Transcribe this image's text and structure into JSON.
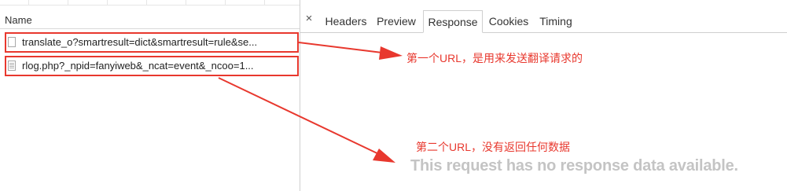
{
  "requests": {
    "column_header": "Name",
    "rows": [
      {
        "name": "translate_o?smartresult=dict&smartresult=rule&se..."
      },
      {
        "name": "rlog.php?_npid=fanyiweb&_ncat=event&_ncoo=1..."
      }
    ]
  },
  "details": {
    "close_symbol": "×",
    "tabs": [
      {
        "label": "Headers"
      },
      {
        "label": "Preview"
      },
      {
        "label": "Response",
        "active": true
      },
      {
        "label": "Cookies"
      },
      {
        "label": "Timing"
      }
    ],
    "empty_message": "This request has no response data available."
  },
  "annotations": {
    "first_url_note": "第一个URL，是用来发送翻译请求的",
    "second_url_note": "第二个URL，没有返回任何数据",
    "color": "#e8382e"
  }
}
